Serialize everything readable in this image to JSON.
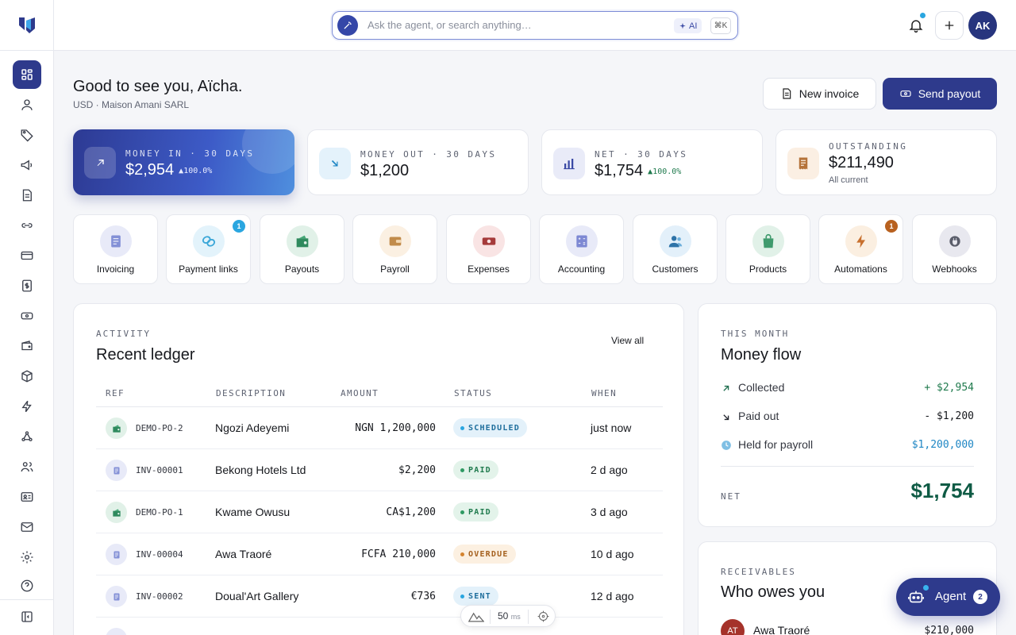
{
  "colors": {
    "brand": "#2e3a8c",
    "accent": "#2aa6e0",
    "positive": "#1f7a4d",
    "net": "#0f5b45"
  },
  "sidebar": {
    "items": [
      {
        "icon": "dashboard-icon"
      },
      {
        "icon": "user-icon"
      },
      {
        "icon": "tag-icon"
      },
      {
        "icon": "megaphone-icon"
      },
      {
        "icon": "document-icon"
      },
      {
        "icon": "link-icon"
      },
      {
        "icon": "credit-card-icon"
      },
      {
        "icon": "dollar-doc-icon"
      },
      {
        "icon": "banknote-icon"
      },
      {
        "icon": "wallet-icon"
      },
      {
        "icon": "box-icon"
      },
      {
        "icon": "lightning-icon"
      },
      {
        "icon": "webhook-icon"
      },
      {
        "icon": "users-icon"
      },
      {
        "icon": "id-card-icon"
      },
      {
        "icon": "mail-icon"
      },
      {
        "icon": "gear-icon"
      },
      {
        "icon": "help-icon"
      },
      {
        "icon": "collapse-sidebar-icon"
      }
    ]
  },
  "topbar": {
    "search_placeholder": "Ask the agent, or search anything…",
    "ai_label": "AI",
    "shortcut": "⌘K",
    "avatar_initials": "AK"
  },
  "header": {
    "greeting": "Good to see you, Aïcha.",
    "subtitle": "USD · Maison Amani SARL",
    "new_invoice": "New invoice",
    "send_payout": "Send payout"
  },
  "stats": [
    {
      "label": "MONEY IN · 30 DAYS",
      "value": "$2,954",
      "delta": "▲100.0%"
    },
    {
      "label": "MONEY OUT · 30 DAYS",
      "value": "$1,200",
      "delta": ""
    },
    {
      "label": "NET · 30 DAYS",
      "value": "$1,754",
      "delta": "▲100.0%"
    },
    {
      "label": "OUTSTANDING",
      "value": "$211,490",
      "note": "All current"
    }
  ],
  "apps": [
    {
      "label": "Invoicing",
      "badge": ""
    },
    {
      "label": "Payment links",
      "badge": "1"
    },
    {
      "label": "Payouts",
      "badge": ""
    },
    {
      "label": "Payroll",
      "badge": ""
    },
    {
      "label": "Expenses",
      "badge": ""
    },
    {
      "label": "Accounting",
      "badge": ""
    },
    {
      "label": "Customers",
      "badge": ""
    },
    {
      "label": "Products",
      "badge": ""
    },
    {
      "label": "Automations",
      "badge": "1"
    },
    {
      "label": "Webhooks",
      "badge": ""
    }
  ],
  "ledger": {
    "eyebrow": "ACTIVITY",
    "title": "Recent ledger",
    "view_all": "View all",
    "columns": [
      "REF",
      "DESCRIPTION",
      "AMOUNT",
      "STATUS",
      "WHEN"
    ],
    "rows": [
      {
        "ref": "DEMO-PO-2",
        "description": "Ngozi Adeyemi",
        "amount": "NGN 1,200,000",
        "status": "SCHEDULED",
        "when": "just now",
        "kind": "payout"
      },
      {
        "ref": "INV-00001",
        "description": "Bekong Hotels Ltd",
        "amount": "$2,200",
        "status": "PAID",
        "when": "2 d ago",
        "kind": "invoice"
      },
      {
        "ref": "DEMO-PO-1",
        "description": "Kwame Owusu",
        "amount": "CA$1,200",
        "status": "PAID",
        "when": "3 d ago",
        "kind": "payout"
      },
      {
        "ref": "INV-00004",
        "description": "Awa Traoré",
        "amount": "FCFA 210,000",
        "status": "OVERDUE",
        "when": "10 d ago",
        "kind": "invoice"
      },
      {
        "ref": "INV-00002",
        "description": "Doual'Art Gallery",
        "amount": "€736",
        "status": "SENT",
        "when": "12 d ago",
        "kind": "invoice"
      }
    ]
  },
  "money_flow": {
    "eyebrow": "THIS MONTH",
    "title": "Money flow",
    "rows": [
      {
        "label": "Collected",
        "value": "+ $2,954"
      },
      {
        "label": "Paid out",
        "value": "- $1,200"
      },
      {
        "label": "Held for payroll",
        "value": "$1,200,000"
      }
    ],
    "net_label": "NET",
    "net_value": "$1,754"
  },
  "receivables": {
    "eyebrow": "RECEIVABLES",
    "title": "Who owes you",
    "first": {
      "initials": "AT",
      "name": "Awa Traoré",
      "amount": "$210,000"
    }
  },
  "agent": {
    "label": "Agent",
    "count": "2"
  },
  "perf": {
    "ms": "50",
    "unit": "ms"
  }
}
